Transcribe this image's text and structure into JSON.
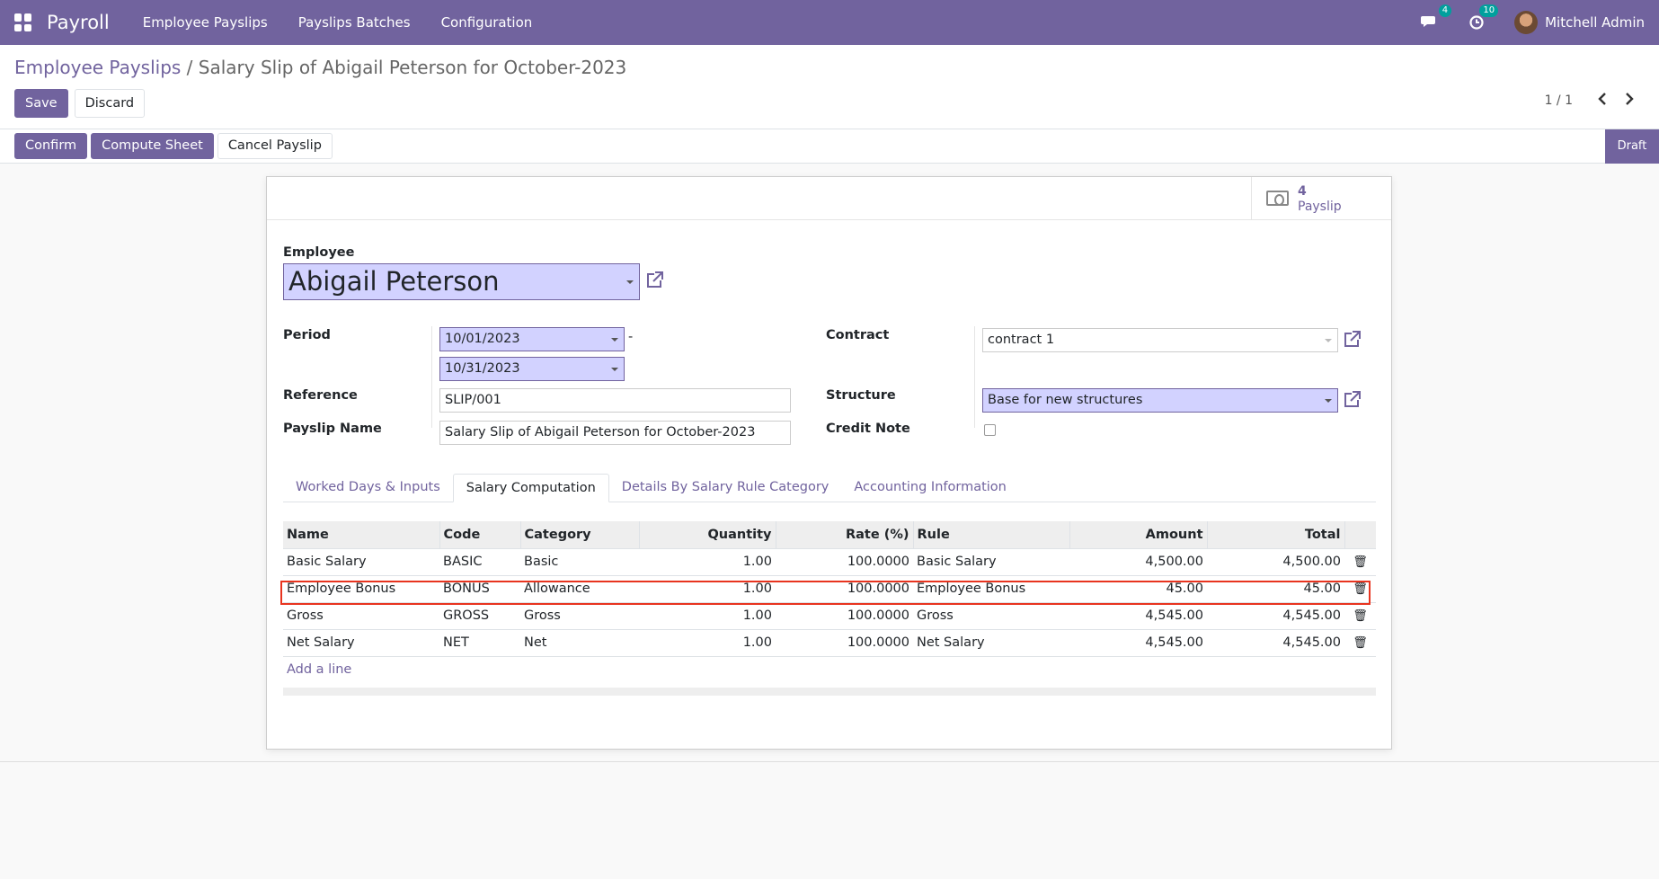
{
  "navbar": {
    "app_name": "Payroll",
    "menu": [
      "Employee Payslips",
      "Payslips Batches",
      "Configuration"
    ],
    "messages_count": "4",
    "activities_count": "10",
    "user_name": "Mitchell Admin",
    "color": "#71639e"
  },
  "breadcrumb": {
    "parent": "Employee Payslips",
    "separator": "/",
    "current": "Salary Slip of Abigail Peterson for October-2023"
  },
  "control": {
    "save_label": "Save",
    "discard_label": "Discard",
    "pager_value": "1 / 1"
  },
  "statusbar": {
    "buttons": [
      "Confirm",
      "Compute Sheet",
      "Cancel Payslip"
    ],
    "status": "Draft"
  },
  "smart_button": {
    "value": "4",
    "label": "Payslip",
    "icon": "money-icon"
  },
  "form": {
    "employee_label": "Employee",
    "employee_value": "Abigail Peterson",
    "period_label": "Period",
    "date_from": "10/01/2023",
    "date_sep": "-",
    "date_to": "10/31/2023",
    "reference_label": "Reference",
    "reference_value": "SLIP/001",
    "payslip_name_label": "Payslip Name",
    "payslip_name_value": "Salary Slip of Abigail Peterson for October-2023",
    "contract_label": "Contract",
    "contract_value": "contract 1",
    "structure_label": "Structure",
    "structure_value": "Base for new structures",
    "credit_note_label": "Credit Note",
    "credit_note_checked": false
  },
  "tabs": [
    "Worked Days & Inputs",
    "Salary Computation",
    "Details By Salary Rule Category",
    "Accounting Information"
  ],
  "active_tab": "Salary Computation",
  "table": {
    "columns": [
      "Name",
      "Code",
      "Category",
      "Quantity",
      "Rate (%)",
      "Rule",
      "Amount",
      "Total"
    ],
    "rows": [
      [
        "Basic Salary",
        "BASIC",
        "Basic",
        "1.00",
        "100.0000",
        "Basic Salary",
        "4,500.00",
        "4,500.00"
      ],
      [
        "Employee Bonus",
        "BONUS",
        "Allowance",
        "1.00",
        "100.0000",
        "Employee Bonus",
        "45.00",
        "45.00"
      ],
      [
        "Gross",
        "GROSS",
        "Gross",
        "1.00",
        "100.0000",
        "Gross",
        "4,545.00",
        "4,545.00"
      ],
      [
        "Net Salary",
        "NET",
        "Net",
        "1.00",
        "100.0000",
        "Net Salary",
        "4,545.00",
        "4,545.00"
      ]
    ],
    "add_line": "Add a line",
    "highlighted_row": "Employee Bonus",
    "highlight_color": "#e8341f"
  }
}
